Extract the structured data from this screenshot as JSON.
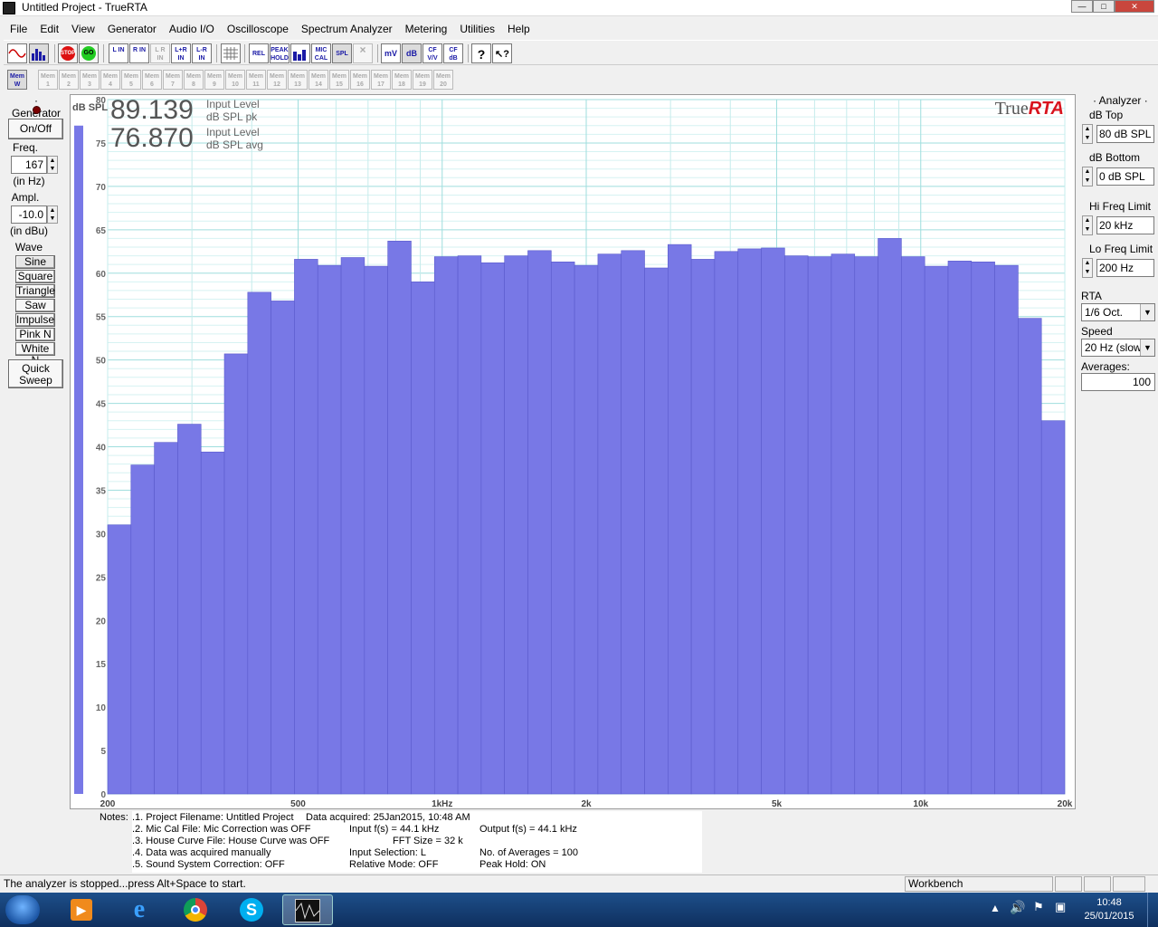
{
  "window": {
    "title": "Untitled Project - TrueRTA"
  },
  "menu": [
    "File",
    "Edit",
    "View",
    "Generator",
    "Audio I/O",
    "Oscilloscope",
    "Spectrum Analyzer",
    "Metering",
    "Utilities",
    "Help"
  ],
  "toolbar": {
    "stop_label": "STOP",
    "go_label": "GO",
    "l_in": "L IN",
    "r_in": "R IN",
    "lr_in": "L R IN",
    "lplusr_in": "L+R IN",
    "lminusr_in": "L-R IN",
    "rel": "REL",
    "peak_hold": "PEAK HOLD",
    "mic_cal": "MIC CAL",
    "spl": "SPL",
    "mv": "mV",
    "db": "dB",
    "cf_vv": "CF V/V",
    "cf_db": "CF dB",
    "help_q": "?",
    "help_ptr": "↖?"
  },
  "memory": {
    "w_label": "Mem W",
    "slots": [
      "1",
      "2",
      "3",
      "4",
      "5",
      "6",
      "7",
      "8",
      "9",
      "10",
      "11",
      "12",
      "13",
      "14",
      "15",
      "16",
      "17",
      "18",
      "19",
      "20"
    ],
    "prefix": "Mem"
  },
  "generator": {
    "title": "Generator",
    "onoff": "On/Off",
    "freq_label": "Freq.",
    "freq_value": "167",
    "freq_unit": "(in Hz)",
    "ampl_label": "Ampl.",
    "ampl_value": "-10.0",
    "ampl_unit": "(in dBu)",
    "wave_label": "Wave",
    "waves": [
      "Sine",
      "Square",
      "Triangle",
      "Saw",
      "Impulse",
      "Pink N",
      "White N"
    ],
    "quick_sweep_1": "Quick",
    "quick_sweep_2": "Sweep"
  },
  "readout": {
    "pk_value": "89.139",
    "pk_label1": "Input Level",
    "pk_label2": "dB SPL pk",
    "avg_value": "76.870",
    "avg_label1": "Input Level",
    "avg_label2": "dB SPL avg"
  },
  "brand": {
    "true": "True",
    "rta": "RTA"
  },
  "chart_data": {
    "type": "bar",
    "ylabel": "dB SPL",
    "ylim": [
      0,
      80
    ],
    "yticks": [
      0,
      5,
      10,
      15,
      20,
      25,
      30,
      35,
      40,
      45,
      50,
      55,
      60,
      65,
      70,
      75,
      80
    ],
    "xscale": "log",
    "xlim": [
      200,
      20000
    ],
    "xtick_labels": [
      {
        "f": 200,
        "label": "200"
      },
      {
        "f": 500,
        "label": "500"
      },
      {
        "f": 1000,
        "label": "1kHz"
      },
      {
        "f": 2000,
        "label": "2k"
      },
      {
        "f": 5000,
        "label": "5k"
      },
      {
        "f": 10000,
        "label": "10k"
      },
      {
        "f": 20000,
        "label": "20k"
      }
    ],
    "resolution": "1/6 octave",
    "values": [
      31.0,
      37.9,
      40.5,
      42.6,
      39.4,
      50.7,
      57.8,
      56.8,
      61.6,
      60.9,
      61.8,
      60.8,
      63.7,
      59.0,
      61.9,
      62.0,
      61.2,
      62.0,
      62.6,
      61.3,
      60.9,
      62.2,
      62.6,
      60.6,
      63.3,
      61.6,
      62.5,
      62.8,
      62.9,
      62.0,
      61.9,
      62.2,
      61.9,
      64.0,
      61.9,
      60.8,
      61.4,
      61.3,
      60.9,
      54.8,
      43.0
    ],
    "input_meter_value": 77.0,
    "bar_color": "#7878e6",
    "grid": true
  },
  "analyzer": {
    "title": "Analyzer",
    "db_top_label": "dB Top",
    "db_top_value": "80 dB SPL",
    "db_bottom_label": "dB Bottom",
    "db_bottom_value": "0 dB SPL",
    "hi_freq_label": "Hi Freq Limit",
    "hi_freq_value": "20 kHz",
    "lo_freq_label": "Lo Freq Limit",
    "lo_freq_value": "200 Hz",
    "rta_res_label": "RTA Resolution:",
    "rta_res_value": "1/6 Oct.",
    "speed_label": "Speed Tradeoff:",
    "speed_value": "20 Hz (slow)",
    "avg_label": "Averages:",
    "avg_value": "100"
  },
  "notes": {
    "title": "Notes:",
    "c1": [
      ".1. Project Filename: Untitled Project",
      ".2. Mic Cal File: Mic Correction was OFF",
      ".3. House Curve File: House Curve was OFF",
      ".4. Data was acquired manually",
      ".5. Sound System Correction: OFF"
    ],
    "data_acquired": "Data acquired: 25Jan2015, 10:48 AM",
    "c2": [
      "Input f(s) = 44.1 kHz",
      "FFT Size = 32 k",
      "Input Selection: L",
      "Relative Mode:  OFF"
    ],
    "c3": [
      "Output f(s) = 44.1 kHz",
      "",
      "No. of Averages = 100",
      "Peak Hold: ON"
    ]
  },
  "status": {
    "message": "The analyzer is stopped...press Alt+Space to start.",
    "mode": "Workbench"
  },
  "taskbar": {
    "time": "10:48",
    "date": "25/01/2015"
  }
}
